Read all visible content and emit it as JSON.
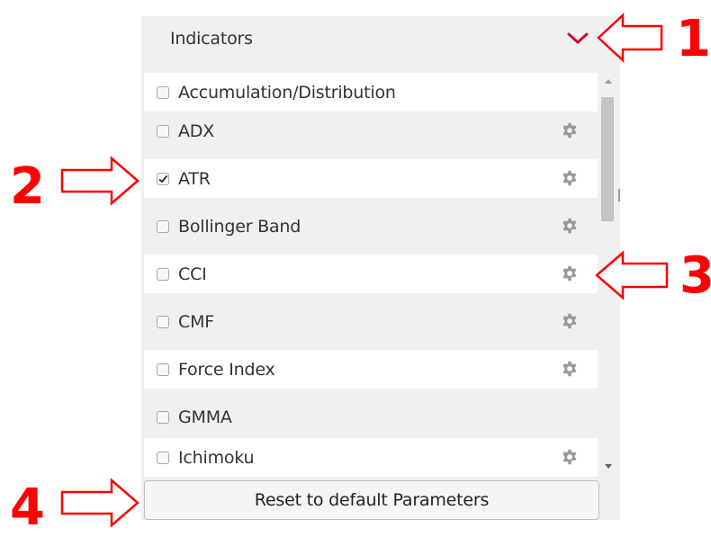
{
  "panel": {
    "header": {
      "title": "Indicators",
      "toggle_icon": "chevron-down-icon"
    },
    "indicators": [
      {
        "label": "Accumulation/Distribution",
        "checked": false,
        "has_settings": false
      },
      {
        "label": "ADX",
        "checked": false,
        "has_settings": true
      },
      {
        "label": "ATR",
        "checked": true,
        "has_settings": true
      },
      {
        "label": "Bollinger Band",
        "checked": false,
        "has_settings": true
      },
      {
        "label": "CCI",
        "checked": false,
        "has_settings": true
      },
      {
        "label": "CMF",
        "checked": false,
        "has_settings": true
      },
      {
        "label": "Force Index",
        "checked": false,
        "has_settings": true
      },
      {
        "label": "GMMA",
        "checked": false,
        "has_settings": false
      },
      {
        "label": "Ichimoku",
        "checked": false,
        "has_settings": true
      }
    ],
    "reset_button_label": "Reset to default Parameters"
  },
  "annotations": {
    "callout_1": "1",
    "callout_2": "2",
    "callout_3": "3",
    "callout_4": "4"
  },
  "colors": {
    "accent_chevron": "#c8102e",
    "callout_red": "#ff0000",
    "gear_gray": "#999999"
  }
}
